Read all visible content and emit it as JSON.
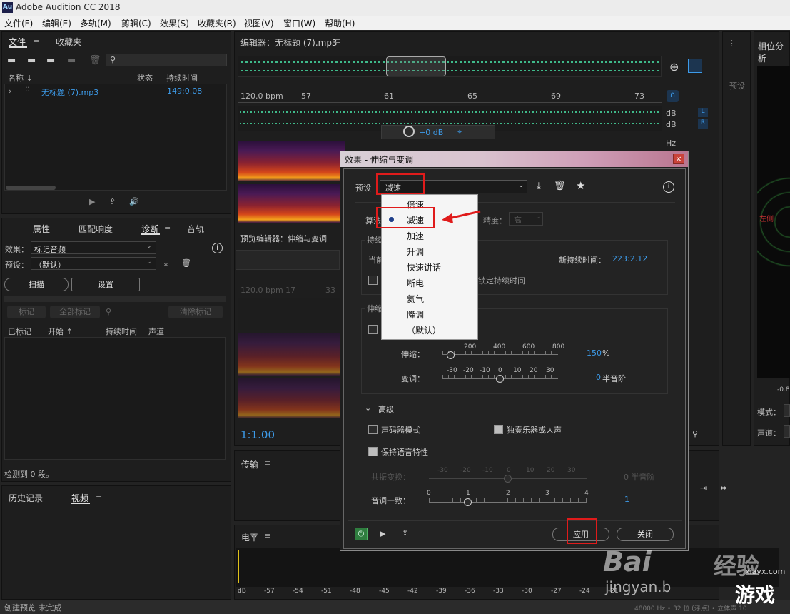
{
  "app": {
    "title": "Adobe Audition CC 2018",
    "logo": "Au"
  },
  "menu": [
    "文件(F)",
    "编辑(E)",
    "多轨(M)",
    "剪辑(C)",
    "效果(S)",
    "收藏夹(R)",
    "视图(V)",
    "窗口(W)",
    "帮助(H)"
  ],
  "files_panel": {
    "tab_files": "文件",
    "tab_favorites": "收藏夹",
    "col_name": "名称 ↓",
    "col_status": "状态",
    "col_duration": "持续时间",
    "file_name": "无标题 (7).mp3",
    "file_duration": "149:0.08"
  },
  "props_panel": {
    "tabs": [
      "属性",
      "匹配响度",
      "诊断",
      "音轨"
    ],
    "effect_label": "效果：",
    "effect_value": "标记音频",
    "preset_label": "预设：",
    "preset_value": "（默认）",
    "scan_btn": "扫描",
    "settings_btn": "设置",
    "mark_btn": "标记",
    "mark_all_btn": "全部标记",
    "clear_btn": "清除标记",
    "cols": [
      "已标记",
      "开始 ↑",
      "持续时间",
      "声道"
    ],
    "detected": "检测到 0 段。"
  },
  "history_panel": {
    "tab_history": "历史记录",
    "tab_video": "视频"
  },
  "editor": {
    "title": "编辑器：无标题 (7).mp3",
    "bpm": "120.0 bpm",
    "ruler": [
      "57",
      "61",
      "65",
      "69",
      "73"
    ],
    "db1": "dB",
    "db2": "dB",
    "L": "L",
    "R": "R",
    "hz": "Hz",
    "gain": "+0 dB"
  },
  "preview": {
    "title": "预览编辑器：伸缩与变调",
    "bpm": "120.0 bpm 17",
    "tick": "33",
    "zoom": "1:1.00"
  },
  "transport": {
    "label": "传输"
  },
  "levels": {
    "label": "电平",
    "scale": [
      "dB",
      "-57",
      "-54",
      "-51",
      "-48",
      "-45",
      "-42",
      "-39",
      "-36",
      "-33",
      "-30",
      "-27",
      "-24",
      "-21"
    ]
  },
  "right_panel": {
    "title": "相位分析",
    "preset_side": "预设",
    "left_ch": "左侧",
    "val": "-0.8",
    "mode": "模式：",
    "channel": "声道："
  },
  "status": {
    "left": "创建预览 未完成",
    "right": "48000 Hz • 32 位 (浮点) • 立体声  10"
  },
  "dialog": {
    "title": "效果 - 伸缩与变调",
    "preset_label": "预设",
    "preset_value": "减速",
    "algorithm_label": "算法",
    "precision_label": "精度：",
    "precision_value": "高",
    "duration_section": "持续",
    "current_label": "当前",
    "new_duration_label": "新持续时间：",
    "new_duration_value": "223:2.12",
    "lock_label": "锁定持续时间",
    "stretch_section": "伸缩",
    "stretch_label": "伸缩：",
    "stretch_ticks": [
      "200",
      "400",
      "600",
      "800"
    ],
    "stretch_value": "150",
    "stretch_unit": "%",
    "pitch_label": "变调：",
    "pitch_ticks": [
      "-30",
      "-20",
      "-10",
      "0",
      "10",
      "20",
      "30"
    ],
    "pitch_value": "0",
    "pitch_unit": "半音阶",
    "advanced_label": "高级",
    "vocoder_label": "声码器模式",
    "solo_label": "独奏乐器或人声",
    "preserve_label": "保持语音特性",
    "formant_label": "共振变换：",
    "formant_ticks": [
      "-30",
      "-20",
      "-10",
      "0",
      "10",
      "20",
      "30"
    ],
    "formant_value": "0 半音阶",
    "pitch_coherence_label": "音调一致：",
    "coherence_ticks": [
      "0",
      "1",
      "2",
      "3",
      "4"
    ],
    "coherence_value": "1",
    "apply_btn": "应用",
    "close_btn": "关闭",
    "dropdown": [
      "倍速",
      "减速",
      "加速",
      "升调",
      "快速讲话",
      "断电",
      "氦气",
      "降调",
      "（默认）"
    ]
  },
  "watermark": {
    "baidu": "Bai",
    "du": "经验",
    "jingyan": "jingyan.b",
    "site": "xiayx.com",
    "game": "游戏"
  }
}
